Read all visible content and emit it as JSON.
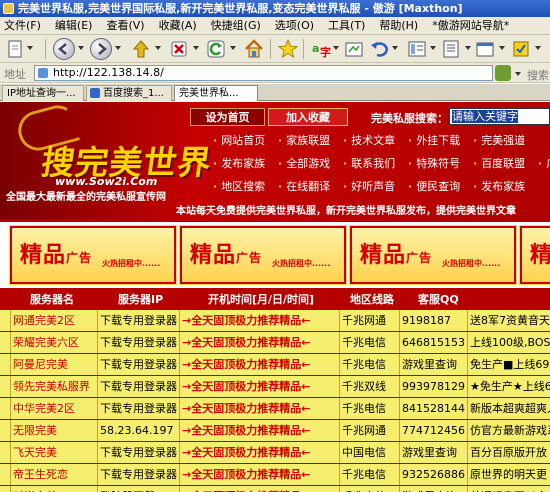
{
  "window": {
    "title": "完美世界私服,完美世界国际私服,新开完美世界私服,变态完美世界私服 - 傲游 [Maxthon]"
  },
  "menu": [
    "文件(F)",
    "编辑(E)",
    "查看(V)",
    "收藏(A)",
    "快捷组(G)",
    "选项(O)",
    "工具(T)",
    "帮助(H)",
    "*傲游网站导航*"
  ],
  "address": {
    "label": "地址",
    "url": "http://122.138.14.8/",
    "search_label": "搜索"
  },
  "tabs": [
    "IP地址查询一...",
    "百度搜索_1...",
    "完美世界私..."
  ],
  "site": {
    "logo": "搜完美世界",
    "logo_url": "www.Sow2i.Com",
    "slogan": "全国最大最新最全的完美私服宣传网",
    "set_home": "设为首页",
    "add_fav": "加入收藏",
    "search_label": "完美私服搜索：",
    "search_value": "请输入关键字",
    "nav": [
      [
        "网站首页",
        "家族联盟",
        "技术文章",
        "外挂下载",
        "完美强道"
      ],
      [
        "发布家族",
        "全部游戏",
        "联系我们",
        "特殊符号",
        "百度联盟",
        "广告"
      ],
      [
        "地区搜索",
        "在线翻译",
        "好听声音",
        "便民查询",
        "发布家族"
      ]
    ],
    "notice": "本站每天免费提供完美世界私服，新开完美世界私服发布，提供完美世界文章"
  },
  "ads": [
    {
      "main": "精品",
      "small": "广告",
      "sub": "火热招租中......"
    },
    {
      "main": "精品",
      "small": "广告",
      "sub": "火热招租中......"
    },
    {
      "main": "精品",
      "small": "广告",
      "sub": "火热招租中......"
    },
    {
      "main": "精",
      "small": "",
      "sub": ""
    }
  ],
  "table": {
    "headers": [
      "服务器名",
      "服务器IP",
      "开机时间[月/日/时间]",
      "地区线路",
      "客服QQ"
    ],
    "rows": [
      [
        "网通完美2区",
        "下载专用登录器",
        "→全天固顶极力推荐精品←",
        "千兆网通",
        "9198187",
        "送8军7资黄音天卡"
      ],
      [
        "荣耀完美六区",
        "下载专用登录器",
        "→全天固顶极力推荐精品←",
        "千兆电信",
        "646815153",
        "上线100级,BOSS掉"
      ],
      [
        "阿曼尼完美",
        "下载专用登录器",
        "→全天固顶极力推荐精品←",
        "千兆电信",
        "游戏里查询",
        "免生产■上线699"
      ],
      [
        "领先完美私服界",
        "下载专用登录器",
        "→全天固顶极力推荐精品←",
        "千兆双线",
        "993978129",
        "★免生产★上线69"
      ],
      [
        "中华完美2区",
        "下载专用登录器",
        "→全天固顶极力推荐精品←",
        "千兆电信",
        "841528144",
        "新版本超爽超爽人"
      ],
      [
        "无限完美",
        "58.23.64.197",
        "→全天固顶极力推荐精品←",
        "千兆网通",
        "774712456",
        "仿官方最新游戏系统"
      ],
      [
        "飞天完美",
        "下载专用登录器",
        "→全天固顶极力推荐精品←",
        "中国电信",
        "游戏里查询",
        "百分百原版开放"
      ],
      [
        "帝王生死恋",
        "下载专用登录器",
        "→全天固顶极力推荐精品←",
        "千兆电信",
        "932526886",
        "原世界的明天更"
      ],
      [
        "时尚完美",
        "登陆器下载",
        "→全天固顶极力推荐精品←",
        "千兆电信",
        "游戏里查询",
        "普通玩家可以合"
      ]
    ]
  }
}
